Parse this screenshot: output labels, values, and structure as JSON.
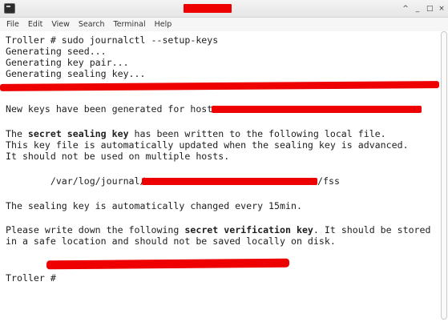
{
  "window": {
    "controls": {
      "minimize_up": "^",
      "minimize": "_",
      "maximize": "□",
      "close": "×"
    },
    "icon": "terminal-icon"
  },
  "menu": {
    "file": "File",
    "edit": "Edit",
    "view": "View",
    "search": "Search",
    "terminal": "Terminal",
    "help": "Help"
  },
  "terminal": {
    "lines": [
      "Troller # sudo journalctl --setup-keys",
      "Generating seed...",
      "Generating key pair...",
      "Generating sealing key...",
      "",
      "New keys have been generated for host ",
      "",
      "The ",
      "This key file is automatically updated when the sealing key is advanced.",
      "It should not be used on multiple hosts.",
      "",
      "        /var/log/journal/",
      "",
      "The sealing key is automatically changed every 15min.",
      "",
      "Please write down the following ",
      "in a safe location and should not be saved locally on disk.",
      "",
      "",
      "Troller #"
    ],
    "secret_line": {
      "prefix": "The ",
      "bold": "secret sealing key",
      "suffix": " has been written to the following local file."
    },
    "verification_line": {
      "prefix": "Please write down the following ",
      "bold": "secret verification key",
      "suffix": ". It should be stored"
    },
    "fss_suffix": "/fss"
  },
  "colors": {
    "redaction": "#ee0000",
    "text": "#1e1e1e",
    "background": "#ffffff"
  }
}
